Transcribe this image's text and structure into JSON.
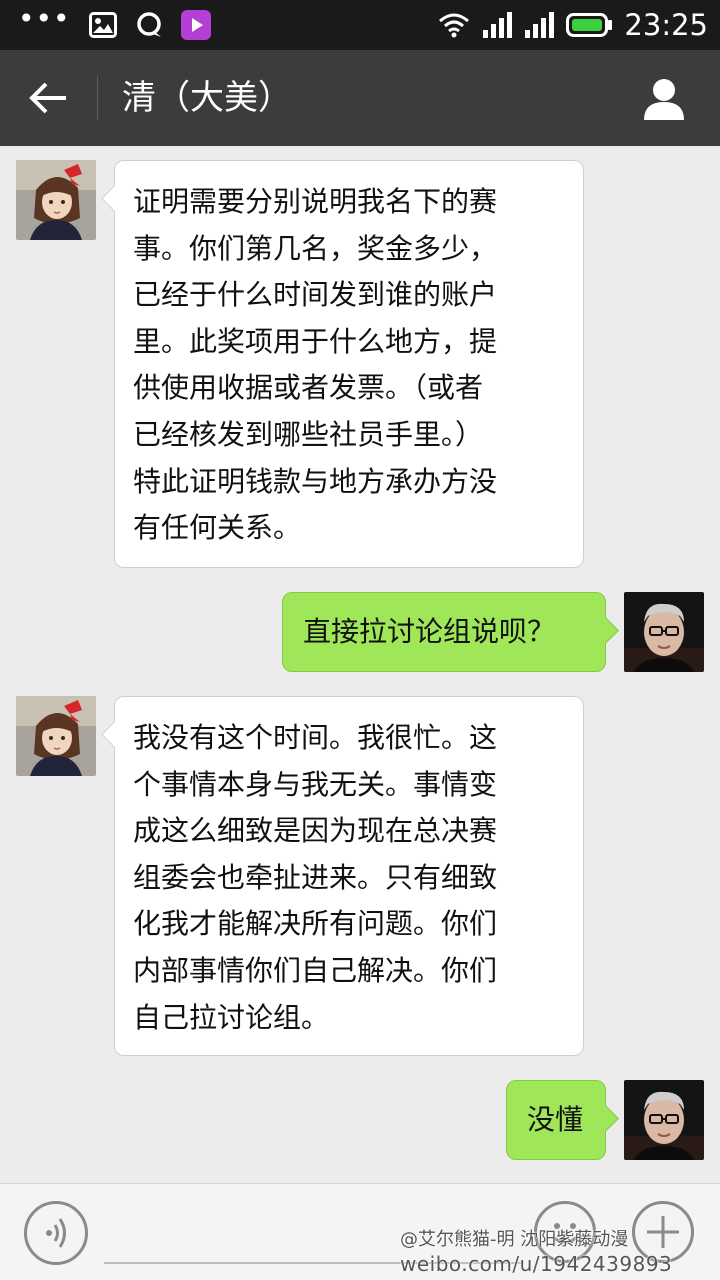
{
  "status_bar": {
    "dots": "•••",
    "time": "23:25",
    "icons": [
      "gallery-icon",
      "chat-bubble-icon",
      "video-player-icon",
      "wifi-icon",
      "signal-icon",
      "signal-icon-2",
      "battery-icon"
    ]
  },
  "header": {
    "title": "清（大美）",
    "back_icon": "back-arrow-icon",
    "profile_icon": "person-icon"
  },
  "messages": [
    {
      "direction": "in",
      "sender_avatar": "anime-girl-avatar",
      "text": "证明需要分别说明我名下的赛\n事。你们第几名，奖金多少，\n已经于什么时间发到谁的账户\n里。此奖项用于什么地方，提\n供使用收据或者发票。（或者\n已经核发到哪些社员手里。）\n特此证明钱款与地方承办方没\n有任何关系。"
    },
    {
      "direction": "out",
      "sender_avatar": "man-glasses-avatar",
      "text": "直接拉讨论组说呗？"
    },
    {
      "direction": "in",
      "sender_avatar": "anime-girl-avatar",
      "text": "我没有这个时间。我很忙。这\n个事情本身与我无关。事情变\n成这么细致是因为现在总决赛\n组委会也牵扯进来。只有细致\n化我才能解决所有问题。你们\n内部事情你们自己解决。你们\n自己拉讨论组。"
    },
    {
      "direction": "out",
      "sender_avatar": "man-glasses-avatar",
      "text": "没懂"
    }
  ],
  "input_bar": {
    "voice_icon": "voice-icon",
    "emoji_icon": "emoji-icon",
    "plus_icon": "plus-icon"
  },
  "watermark": {
    "line1": "@艾尔熊猫-明 沈阳紫藤动漫",
    "line2": "weibo.com/u/1942439893"
  },
  "colors": {
    "header_bg": "#3a3c3e",
    "chat_bg": "#ececec",
    "out_bubble": "#9fe658",
    "in_bubble": "#ffffff"
  }
}
